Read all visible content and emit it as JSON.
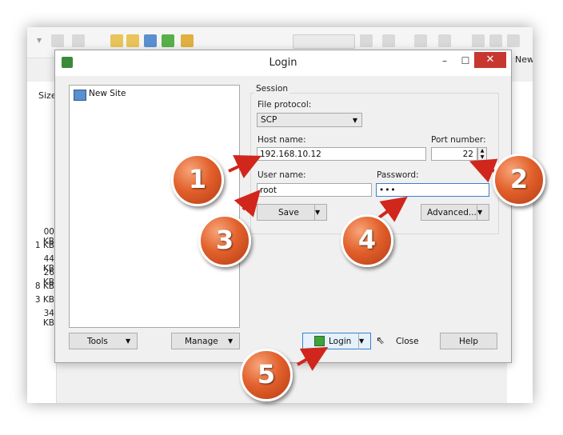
{
  "background": {
    "size_header": "Size",
    "file_sizes": [
      "00 KB",
      "1 KB",
      "44 KB",
      "26 KB",
      "8 KB",
      "3 KB",
      "34 KB"
    ],
    "new_tab_label": "New"
  },
  "dialog": {
    "title": "Login",
    "minimize_glyph": "–",
    "maximize_glyph": "☐",
    "close_glyph": "✕",
    "tree": {
      "new_site_label": "New Site"
    },
    "session": {
      "group_label": "Session",
      "file_protocol_label": "File protocol:",
      "file_protocol_value": "SCP",
      "host_name_label": "Host name:",
      "host_name_value": "192.168.10.12",
      "port_number_label": "Port number:",
      "port_number_value": "22",
      "user_name_label": "User name:",
      "user_name_value": "root",
      "password_label": "Password:",
      "password_value": "•••",
      "save_label": "Save",
      "advanced_label": "Advanced..."
    },
    "bottom": {
      "tools_label": "Tools",
      "manage_label": "Manage",
      "login_label": "Login",
      "close_label": "Close",
      "help_label": "Help"
    }
  },
  "callouts": [
    "1",
    "2",
    "3",
    "4",
    "5"
  ],
  "colors": {
    "callout": "#e2612c",
    "arrow": "#d1261b",
    "close_button": "#c7372f",
    "focus_border": "#3c7fd1"
  }
}
